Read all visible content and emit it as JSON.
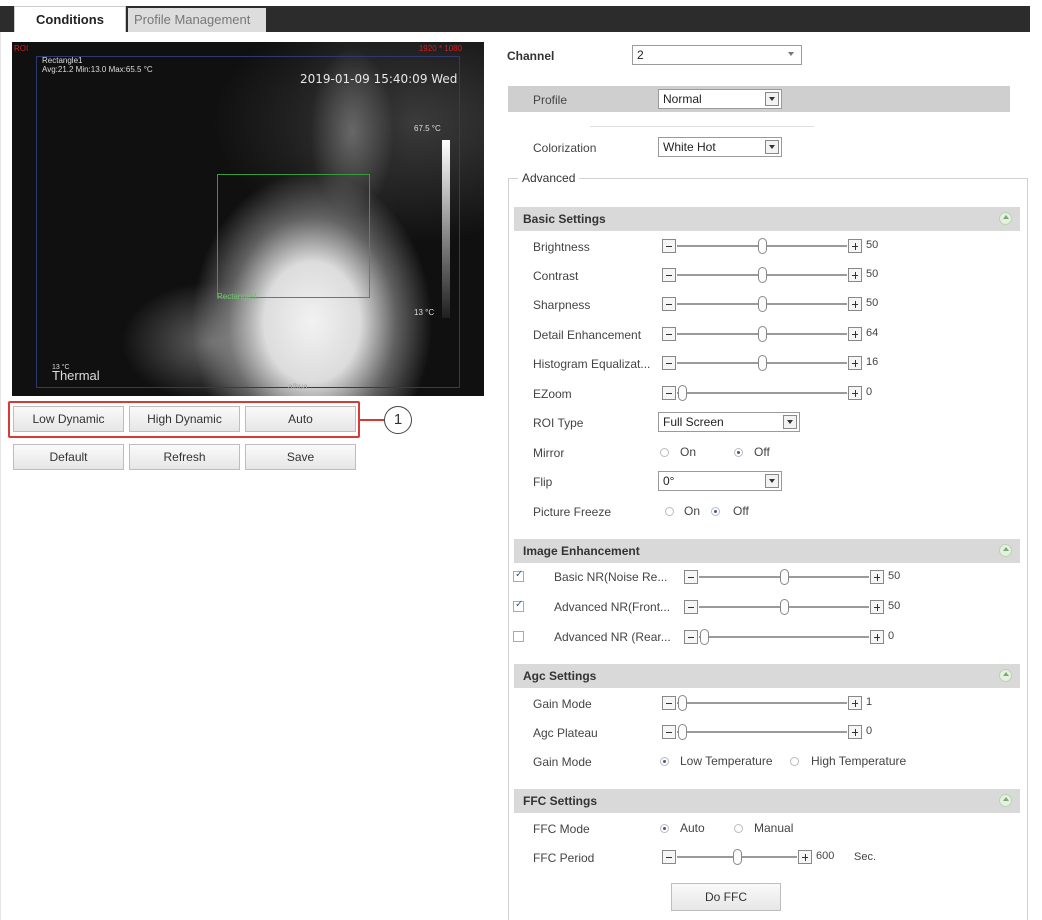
{
  "tabs": [
    {
      "label": "Conditions"
    },
    {
      "label": "Profile Management"
    }
  ],
  "video": {
    "top_left_red": "ROI",
    "top_right_red": "1920 * 1080",
    "rect_label_line1": "Rectangle1",
    "rect_label_line2": "Avg:21.2 Min:13.0 Max:65.5 °C",
    "timestamp": "2019-01-09 15:40:09 Wed",
    "scale_top": "67.5 °C",
    "scale_bottom": "13 °C",
    "roi_label": "Rectangle1",
    "bottom_small": "13 °C",
    "channel_name": "Thermal",
    "watermark": "alhua"
  },
  "left_buttons": {
    "low_dynamic": "Low Dynamic",
    "high_dynamic": "High Dynamic",
    "auto": "Auto",
    "default": "Default",
    "refresh": "Refresh",
    "save": "Save"
  },
  "callout": "1",
  "channel": {
    "label": "Channel",
    "value": "2"
  },
  "profile": {
    "label": "Profile",
    "value": "Normal"
  },
  "colorization": {
    "label": "Colorization",
    "value": "White Hot"
  },
  "advanced": {
    "legend": "Advanced"
  },
  "basic_settings": {
    "title": "Basic Settings",
    "brightness": {
      "label": "Brightness",
      "value": "50",
      "fraction": 0.5
    },
    "contrast": {
      "label": "Contrast",
      "value": "50",
      "fraction": 0.5
    },
    "sharpness": {
      "label": "Sharpness",
      "value": "50",
      "fraction": 0.5
    },
    "detail": {
      "label": "Detail Enhancement",
      "value": "64",
      "fraction": 0.5
    },
    "histogram": {
      "label": "Histogram Equalizat...",
      "value": "16",
      "fraction": 0.5
    },
    "ezoom": {
      "label": "EZoom",
      "value": "0",
      "fraction": 0.0
    },
    "roi_type": {
      "label": "ROI Type",
      "value": "Full Screen"
    },
    "mirror": {
      "label": "Mirror",
      "on": "On",
      "off": "Off"
    },
    "flip": {
      "label": "Flip",
      "value": "0°"
    },
    "freeze": {
      "label": "Picture Freeze",
      "on": "On",
      "off": "Off"
    }
  },
  "image_enhancement": {
    "title": "Image Enhancement",
    "basic_nr": {
      "label": "Basic NR(Noise Re...",
      "value": "50",
      "fraction": 0.5
    },
    "adv_nr_front": {
      "label": "Advanced NR(Front...",
      "value": "50",
      "fraction": 0.5
    },
    "adv_nr_rear": {
      "label": "Advanced NR (Rear...",
      "value": "0",
      "fraction": 0.0
    }
  },
  "agc_settings": {
    "title": "Agc Settings",
    "gain_mode": {
      "label": "Gain Mode",
      "value": "1",
      "fraction": 0.0
    },
    "agc_plateau": {
      "label": "Agc Plateau",
      "value": "0",
      "fraction": 0.0
    },
    "gain_mode_radio": {
      "label": "Gain Mode",
      "low": "Low Temperature",
      "high": "High Temperature"
    }
  },
  "ffc_settings": {
    "title": "FFC Settings",
    "ffc_mode": {
      "label": "FFC Mode",
      "auto": "Auto",
      "manual": "Manual"
    },
    "ffc_period": {
      "label": "FFC Period",
      "value": "600",
      "unit": "Sec.",
      "fraction": 0.5
    },
    "do_ffc": "Do FFC"
  }
}
